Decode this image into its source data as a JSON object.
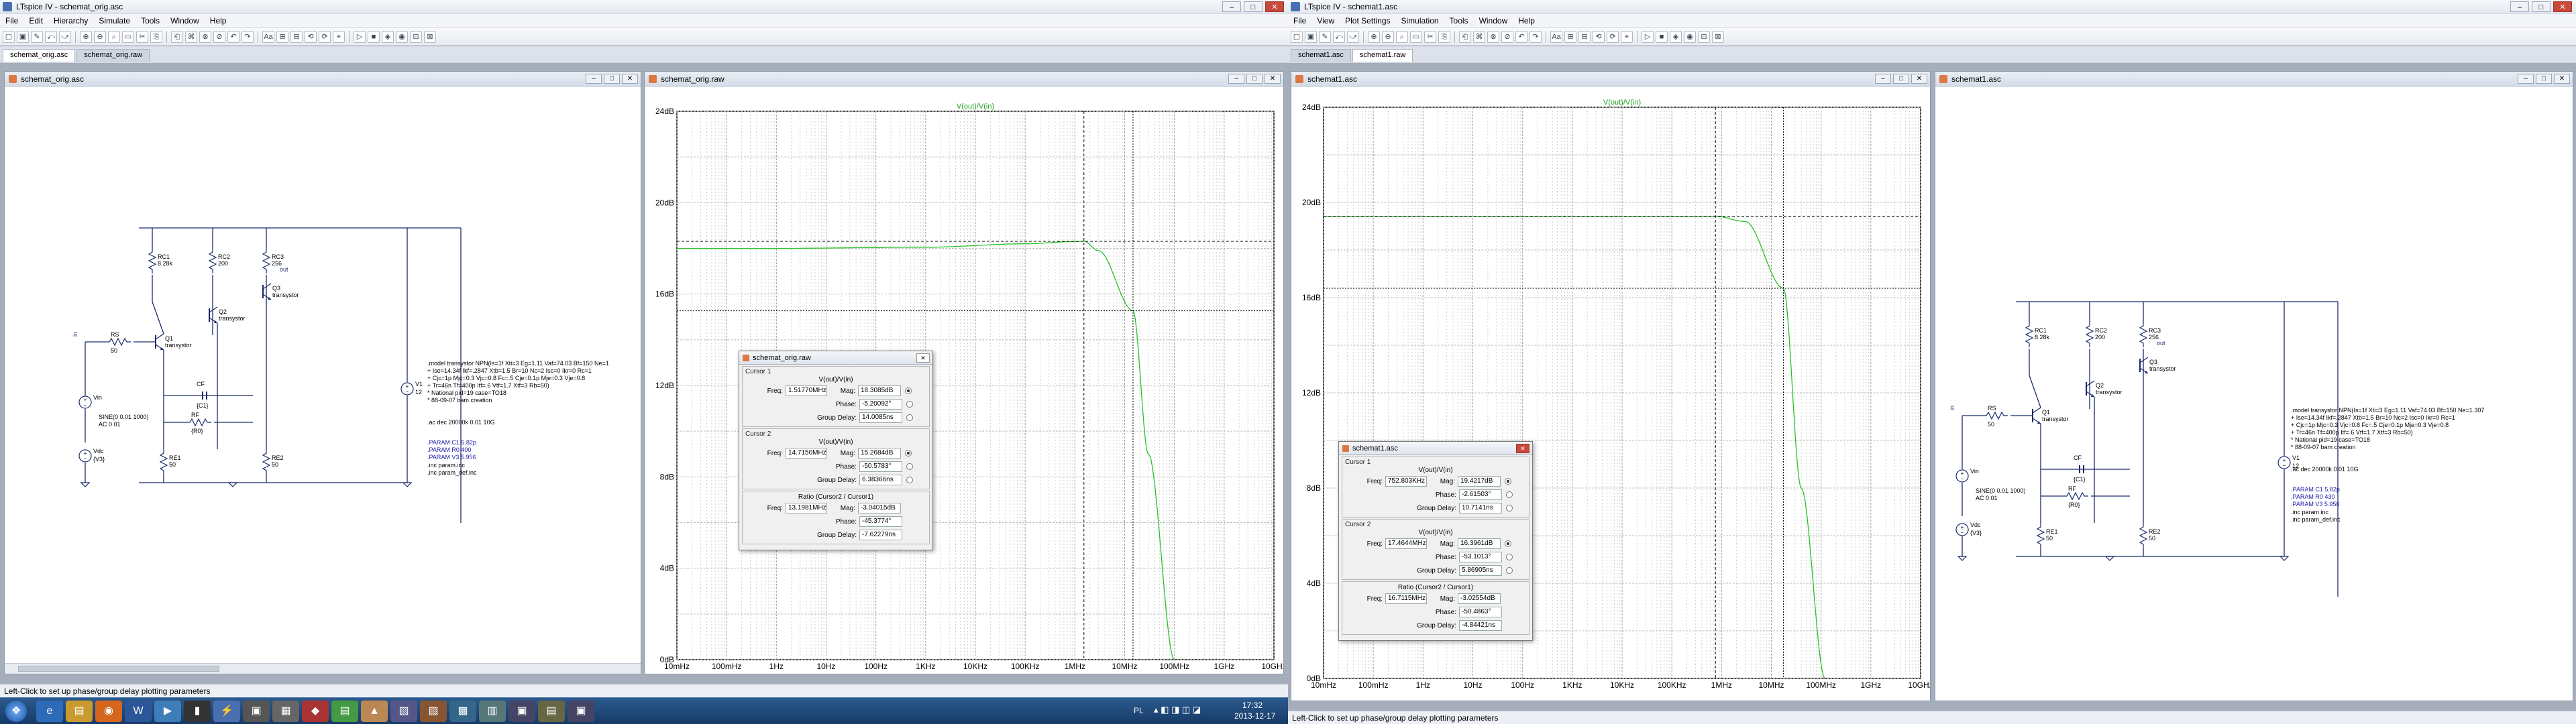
{
  "left": {
    "title": "LTspice IV - schemat_orig.asc",
    "menu": [
      "File",
      "Edit",
      "Hierarchy",
      "Simulate",
      "Tools",
      "Window",
      "Help"
    ],
    "tabs": [
      "schemat_orig.asc",
      "schemat_orig.raw"
    ],
    "schematic_window": {
      "title": "schemat_orig.asc"
    },
    "plot_window": {
      "title": "schemat_orig.raw",
      "trace": "V(out)/V(in)"
    },
    "status": "Left-Click to set up phase/group delay plotting parameters",
    "schematic": {
      "RC1": "RC1",
      "RC1v": "8.28k",
      "RC2": "RC2",
      "RC2v": "200",
      "RC3": "RC3",
      "RC3v": "256",
      "Q1": "Q1",
      "Q2": "Q2",
      "Q3": "Q3",
      "tr": "transystor",
      "out": "out",
      "in": "in",
      "RS": "RS",
      "RSv": "50",
      "CF": "CF",
      "CFv": "{C1}",
      "RF": "RF",
      "RFv": "{R0}",
      "RE1": "RE1",
      "RE1v": "50",
      "RE2": "RE2",
      "RE2v": "50",
      "V1": "V1",
      "V1v": "12",
      "Vin": "Vin",
      "VinSrc": "SINE(0 0.01 1000)",
      "VinAC": "AC 0.01",
      "Vdc": "Vdc",
      "Vdcv": "{V3}",
      "model": [
        ".model transystor NPN(Is=1f Xti=3 Eg=1.11 Vaf=74.03 Bf=150 Ne=1",
        "+ Ise=14.34f Ikf=.2847 Xtb=1.5 Br=10 Nc=2 Isc=0 Ikr=0 Rc=1",
        "+ Cjc=1p Mjc=0.3 Vjc=0.8 Fc=.5 Cje=0.1p Mje=0.3 Vje=0.8",
        "+ Tr=46n Tf=400p Itf=.6 Vtf=1.7 Xtf=3 Rb=50)",
        "* National pid=19 case=TO18",
        "* 88-09-07 bam creation"
      ],
      "ac": ".ac dec 20000k 0.01 10G",
      "params": [
        ".PARAM C1 5.82p",
        ".PARAM R0 400",
        ".PARAM V3 5.956"
      ],
      "inc": [
        ".inc param.inc",
        ".inc param_def.inc"
      ]
    },
    "plot": {
      "yticks": [
        "24dB",
        "20dB",
        "16dB",
        "12dB",
        "8dB",
        "4dB",
        "0dB"
      ],
      "xticks": [
        "10mHz",
        "100mHz",
        "1Hz",
        "10Hz",
        "100Hz",
        "1KHz",
        "10KHz",
        "100KHz",
        "1MHz",
        "10MHz",
        "100MHz",
        "1GHz",
        "10GHz"
      ]
    },
    "cursor_dialog": {
      "title": "schemat_orig.raw",
      "c1": {
        "label": "Cursor 1",
        "sig": "V(out)/V(in)",
        "freq": "1.51770MHz",
        "mag": "18.3085dB",
        "phase": "-5.20092°",
        "gd": "14.0085ns"
      },
      "c2": {
        "label": "Cursor 2",
        "sig": "V(out)/V(in)",
        "freq": "14.7150MHz",
        "mag": "15.2684dB",
        "phase": "-50.5783°",
        "gd": "6.38366ns"
      },
      "ratio": {
        "label": "Ratio (Cursor2 / Cursor1)",
        "freq": "13.1981MHz",
        "mag": "-3.04015dB",
        "phase": "-45.3774°",
        "gd": "-7.62279ns"
      },
      "labels": {
        "freq": "Freq:",
        "mag": "Mag:",
        "phase": "Phase:",
        "gd": "Group Delay:"
      }
    }
  },
  "right": {
    "title": "LTspice IV - schemat1.asc",
    "menu": [
      "File",
      "View",
      "Plot Settings",
      "Simulation",
      "Tools",
      "Window",
      "Help"
    ],
    "tabs": [
      "schemat1.asc",
      "schemat1.raw"
    ],
    "plot_window": {
      "title": "schemat1.asc",
      "trace": "V(out)/V(in)"
    },
    "schematic_window": {
      "title": "schemat1.asc"
    },
    "status": "Left-Click to set up phase/group delay plotting parameters",
    "plot": {
      "yticks": [
        "24dB",
        "20dB",
        "16dB",
        "12dB",
        "8dB",
        "4dB",
        "0dB"
      ],
      "xticks": [
        "10mHz",
        "100mHz",
        "1Hz",
        "10Hz",
        "100Hz",
        "1KHz",
        "10KHz",
        "100KHz",
        "1MHz",
        "10MHz",
        "100MHz",
        "1GHz",
        "10GHz"
      ]
    },
    "cursor_dialog": {
      "title": "schemat1.asc",
      "c1": {
        "label": "Cursor 1",
        "sig": "V(out)/V(in)",
        "freq": "752.803KHz",
        "mag": "19.4217dB",
        "phase": "-2.61503°",
        "gd": "10.7141ns"
      },
      "c2": {
        "label": "Cursor 2",
        "sig": "V(out)/V(in)",
        "freq": "17.4644MHz",
        "mag": "16.3961dB",
        "phase": "-53.1013°",
        "gd": "5.86905ns"
      },
      "ratio": {
        "label": "Ratio (Cursor2 / Cursor1)",
        "freq": "16.7115MHz",
        "mag": "-3.02554dB",
        "phase": "-50.4863°",
        "gd": "-4.84421ns"
      },
      "labels": {
        "freq": "Freq:",
        "mag": "Mag:",
        "phase": "Phase:",
        "gd": "Group Delay:"
      }
    },
    "schematic": {
      "RC1": "RC1",
      "RC1v": "8.28k",
      "RC2": "RC2",
      "RC2v": "200",
      "RC3": "RC3",
      "RC3v": "256",
      "Q1": "Q1",
      "Q2": "Q2",
      "Q3": "Q3",
      "tr": "transystor",
      "out": "out",
      "in": "in",
      "RS": "RS",
      "RSv": "50",
      "CF": "CF",
      "CFv": "{C1}",
      "RF": "RF",
      "RFv": "{R0}",
      "RE1": "RE1",
      "RE1v": "50",
      "RE2": "RE2",
      "RE2v": "50",
      "V1": "V1",
      "V1v": "12",
      "Vin": "Vin",
      "VinSrc": "SINE(0 0.01 1000)",
      "VinAC": "AC 0.01",
      "Vdc": "Vdc",
      "Vdcv": "{V3}",
      "model": [
        ".model transystor NPN(Is=1f Xti=3 Eg=1.11 Vaf=74.03 Bf=150 Ne=1.307",
        "+ Ise=14.34f Ikf=.2847 Xtb=1.5 Br=10 Nc=2 Isc=0 Ikr=0 Rc=1",
        "+ Cjc=1p Mjc=0.3 Vjc=0.8 Fc=.5 Cje=0.1p Mje=0.3 Vje=0.8",
        "+ Tr=46n Tf=400p Itf=.6 Vtf=1.7 Xtf=3 Rb=50)",
        "* National pid=19 case=TO18",
        "* 88-09-07 bam creation"
      ],
      "ac": ".ac dec 20000k 0.01 10G",
      "params": [
        ".PARAM C1 5.82p",
        ".PARAM R0 430",
        ".PARAM V3 5.956"
      ],
      "inc": [
        ".inc param.inc",
        ".inc param_def.inc"
      ]
    }
  },
  "taskbar": {
    "lang": "PL",
    "time": "17:32",
    "date": "2013-12-17"
  },
  "chart_data": [
    {
      "type": "line",
      "series": [
        {
          "name": "V(out)/V(in)",
          "x_hz": [
            0.01,
            1,
            1000,
            100000,
            1000000,
            1517700,
            3000000,
            14715000,
            30000000,
            100000000
          ],
          "y_db": [
            18.0,
            18.0,
            18.05,
            18.2,
            18.3,
            18.31,
            17.9,
            15.27,
            9.0,
            0
          ]
        }
      ],
      "xscale": "log",
      "xlim_hz": [
        0.01,
        10000000000
      ],
      "ylim_db": [
        0,
        24
      ],
      "cursor1": {
        "freq": "1.51770MHz",
        "mag": "18.3085dB"
      },
      "cursor2": {
        "freq": "14.7150MHz",
        "mag": "15.2684dB"
      }
    },
    {
      "type": "line",
      "series": [
        {
          "name": "V(out)/V(in)",
          "x_hz": [
            0.01,
            1,
            1000,
            100000,
            752803,
            3000000,
            17464400,
            40000000,
            120000000
          ],
          "y_db": [
            19.42,
            19.42,
            19.42,
            19.42,
            19.42,
            19.2,
            16.4,
            8.0,
            0
          ]
        }
      ],
      "xscale": "log",
      "xlim_hz": [
        0.01,
        10000000000
      ],
      "ylim_db": [
        0,
        24
      ],
      "cursor1": {
        "freq": "752.803KHz",
        "mag": "19.4217dB"
      },
      "cursor2": {
        "freq": "17.4644MHz",
        "mag": "16.3961dB"
      }
    }
  ]
}
